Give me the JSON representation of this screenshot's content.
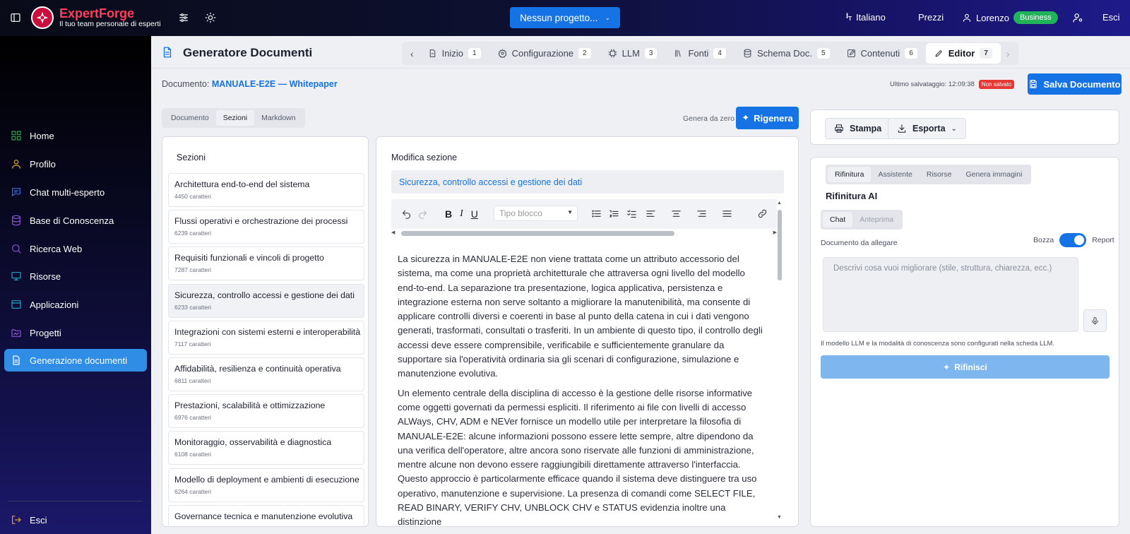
{
  "app": {
    "name": "ExpertForge",
    "tagline": "Il tuo team personale di esperti"
  },
  "topbar": {
    "project_selector": "Nessun progetto...",
    "language": "Italiano",
    "pricing": "Prezzi",
    "user": "Lorenzo",
    "plan_badge": "Business",
    "logout": "Esci"
  },
  "sidebar": {
    "items": [
      {
        "label": "Home",
        "icon": "home-icon",
        "color": "#2ea44f"
      },
      {
        "label": "Profilo",
        "icon": "user-icon",
        "color": "#e0a030"
      },
      {
        "label": "Chat multi-esperto",
        "icon": "chat-icon",
        "color": "#3f6ae0"
      },
      {
        "label": "Base di Conoscenza",
        "icon": "database-icon",
        "color": "#8a55d6"
      },
      {
        "label": "Ricerca Web",
        "icon": "search-icon",
        "color": "#8a55d6"
      },
      {
        "label": "Risorse",
        "icon": "monitor-icon",
        "color": "#24a6c6"
      },
      {
        "label": "Applicazioni",
        "icon": "app-window-icon",
        "color": "#24a6c6"
      },
      {
        "label": "Progetti",
        "icon": "folder-icon",
        "color": "#8a55d6"
      },
      {
        "label": "Generazione documenti",
        "icon": "document-icon",
        "color": "#ffffff",
        "active": true
      }
    ],
    "logout": "Esci"
  },
  "header": {
    "title": "Generatore Documenti",
    "steps": [
      {
        "label": "Inizio",
        "num": "1",
        "icon": "file-icon"
      },
      {
        "label": "Configurazione",
        "num": "2",
        "icon": "gear-icon"
      },
      {
        "label": "LLM",
        "num": "3",
        "icon": "cpu-icon"
      },
      {
        "label": "Fonti",
        "num": "4",
        "icon": "library-icon"
      },
      {
        "label": "Schema Doc.",
        "num": "5",
        "icon": "database-icon"
      },
      {
        "label": "Contenuti",
        "num": "6",
        "icon": "edit-icon"
      },
      {
        "label": "Editor",
        "num": "7",
        "icon": "pen-icon",
        "active": true
      }
    ]
  },
  "doc": {
    "label": "Documento:",
    "name": "MANUALE-E2E — Whitepaper",
    "last_saved_label": "Ultimo salvataggio: 12:09:38",
    "unsaved_badge": "Non salvato",
    "save_button": "Salva Documento"
  },
  "view_tabs": [
    "Documento",
    "Sezioni",
    "Markdown"
  ],
  "regen": {
    "hint": "Genera da zero",
    "button": "Rigenera"
  },
  "sections_panel": {
    "title": "Sezioni",
    "items": [
      {
        "title": "Architettura end-to-end del sistema",
        "count": "4450 caratteri"
      },
      {
        "title": "Flussi operativi e orchestrazione dei processi",
        "count": "6239 caratteri"
      },
      {
        "title": "Requisiti funzionali e vincoli di progetto",
        "count": "7287 caratteri"
      },
      {
        "title": "Sicurezza, controllo accessi e gestione dei dati",
        "count": "6233 caratteri",
        "selected": true
      },
      {
        "title": "Integrazioni con sistemi esterni e interoperabilità",
        "count": "7117 caratteri"
      },
      {
        "title": "Affidabilità, resilienza e continuità operativa",
        "count": "6811 caratteri"
      },
      {
        "title": "Prestazioni, scalabilità e ottimizzazione",
        "count": "6976 caratteri"
      },
      {
        "title": "Monitoraggio, osservabilità e diagnostica",
        "count": "6108 caratteri"
      },
      {
        "title": "Modello di deployment e ambienti di esecuzione",
        "count": "6264 caratteri"
      },
      {
        "title": "Governance tecnica e manutenzione evolutiva",
        "count": ""
      }
    ]
  },
  "editor": {
    "title": "Modifica sezione",
    "section_title": "Sicurezza, controllo accessi e gestione dei dati",
    "block_type_placeholder": "Tipo blocco",
    "paragraphs": [
      "La sicurezza in MANUALE-E2E non viene trattata come un attributo accessorio del sistema, ma come una proprietà architetturale che attraversa ogni livello del modello end-to-end. La separazione tra presentazione, logica applicativa, persistenza e integrazione esterna non serve soltanto a migliorare la manutenibilità, ma consente di applicare controlli diversi e coerenti in base al punto della catena in cui i dati vengono generati, trasformati, consultati o trasferiti. In un ambiente di questo tipo, il controllo degli accessi deve essere comprensibile, verificabile e sufficientemente granulare da supportare sia l'operatività ordinaria sia gli scenari di configurazione, simulazione e manutenzione evolutiva.",
      "Un elemento centrale della disciplina di accesso è la gestione delle risorse informative come oggetti governati da permessi espliciti. Il riferimento ai file con livelli di accesso ALWays, CHV, ADM e NEVer fornisce un modello utile per interpretare la filosofia di MANUALE-E2E: alcune informazioni possono essere lette sempre, altre dipendono da una verifica dell'operatore, altre ancora sono riservate alle funzioni di amministrazione, mentre alcune non devono essere raggiungibili direttamente attraverso l'interfaccia. Questo approccio è particolarmente efficace quando il sistema deve distinguere tra uso operativo, manutenzione e supervisione. La presenza di comandi come SELECT FILE, READ BINARY, VERIFY CHV, UNBLOCK CHV e STATUS evidenzia inoltre una distinzione"
    ]
  },
  "right": {
    "print": "Stampa",
    "export": "Esporta",
    "tabs": [
      "Rifinitura",
      "Assistente",
      "Risorse",
      "Genera immagini"
    ],
    "refine_title": "Rifinitura AI",
    "mode_tabs": [
      "Chat",
      "Anteprima"
    ],
    "attach_label": "Documento da allegare",
    "toggle_left": "Bozza",
    "toggle_right": "Report",
    "textarea_placeholder": "Descrivi cosa vuoi migliorare (stile, struttura, chiarezza, ecc.)",
    "note": "Il modello LLM e la modalità di conoscenza sono configurati nella scheda LLM.",
    "refine_button": "Rifinisci"
  },
  "colors": {
    "primary": "#1673e6",
    "business": "#21b35a",
    "unsaved": "#e53935",
    "brand": "#ff3d5f"
  }
}
